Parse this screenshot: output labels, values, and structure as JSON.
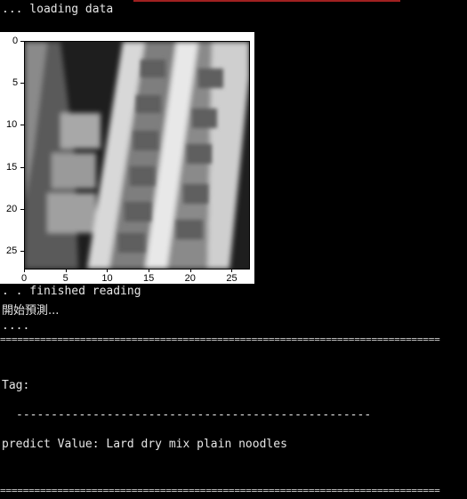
{
  "console": {
    "loading_line": "... loading data",
    "finished_line": ". . finished reading",
    "predict_start_line": "開始預測...",
    "dots_line": "....",
    "separator": "=============================================================================",
    "tag_line": "Tag:",
    "dash_line": "---------------------------------------------------",
    "predict_value_line": "predict Value: Lard dry mix plain noodles"
  },
  "plot": {
    "x_ticks": [
      "0",
      "5",
      "10",
      "15",
      "20",
      "25"
    ],
    "y_ticks": [
      "0",
      "5",
      "10",
      "15",
      "20",
      "25"
    ],
    "xlim": [
      0,
      27
    ],
    "ylim": [
      0,
      27
    ],
    "colormap": "grayscale"
  }
}
